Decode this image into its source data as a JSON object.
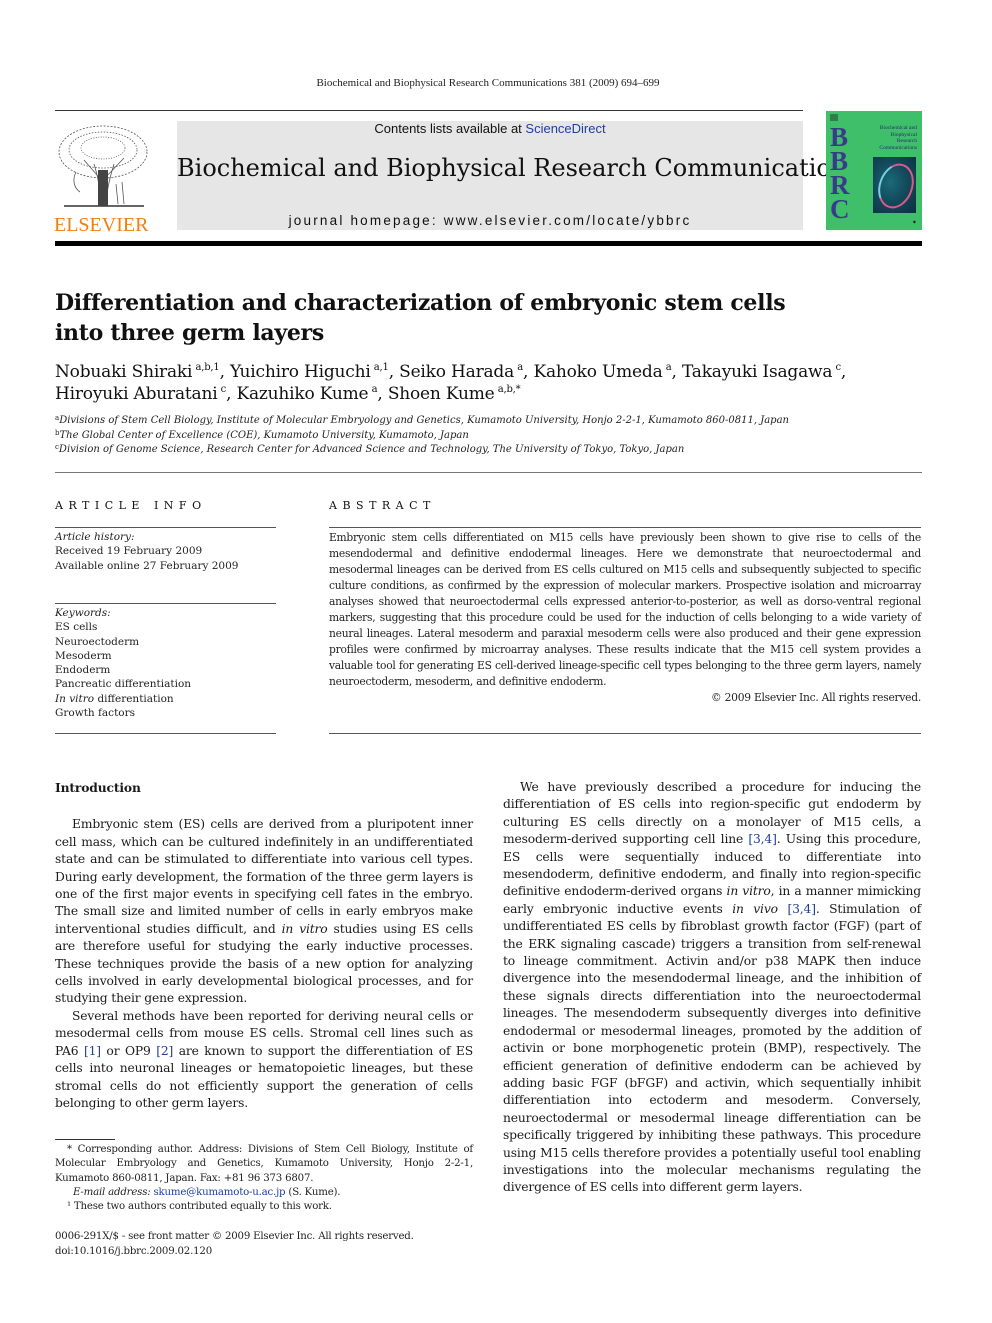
{
  "running_head": "Biochemical and Biophysical Research Communications 381 (2009) 694–699",
  "masthead": {
    "publisher_logo_text": "ELSEVIER",
    "contents_prefix": "Contents lists available at ",
    "contents_link": "ScienceDirect",
    "journal_title": "Biochemical and Biophysical Research Communications",
    "homepage": "journal homepage: www.elsevier.com/locate/ybbrc",
    "cover": {
      "letters": [
        "B",
        "B",
        "R",
        "C"
      ],
      "title_lines": [
        "Biochemical and",
        "Biophysical",
        "Research",
        "Communications"
      ],
      "background_color": "#3fbf6a",
      "letter_color": "#3a3a8c"
    }
  },
  "colors": {
    "elsevier_orange": "#f07f12",
    "link_blue": "#1f3f9c",
    "banner_gray": "#e6e6e6"
  },
  "article": {
    "title_line1": "Differentiation and characterization of embryonic stem cells",
    "title_line2": "into three germ layers",
    "authors": [
      {
        "name": "Nobuaki Shiraki",
        "sup": "a,b,1"
      },
      {
        "name": "Yuichiro Higuchi",
        "sup": "a,1"
      },
      {
        "name": "Seiko Harada",
        "sup": "a"
      },
      {
        "name": "Kahoko Umeda",
        "sup": "a"
      },
      {
        "name": "Takayuki Isagawa",
        "sup": "c"
      },
      {
        "name": "Hiroyuki Aburatani",
        "sup": "c"
      },
      {
        "name": "Kazuhiko Kume",
        "sup": "a"
      },
      {
        "name": "Shoen Kume",
        "sup": "a,b,*"
      }
    ],
    "affiliations": [
      {
        "key": "a",
        "text": "Divisions of Stem Cell Biology, Institute of Molecular Embryology and Genetics, Kumamoto University, Honjo 2-2-1, Kumamoto 860-0811, Japan"
      },
      {
        "key": "b",
        "text": "The Global Center of Excellence (COE), Kumamoto University, Kumamoto, Japan"
      },
      {
        "key": "c",
        "text": "Division of Genome Science, Research Center for Advanced Science and Technology, The University of Tokyo, Tokyo, Japan"
      }
    ]
  },
  "article_info": {
    "heading": "ARTICLE INFO",
    "history_label": "Article history:",
    "received": "Received 19 February 2009",
    "available": "Available online 27 February 2009",
    "keywords_label": "Keywords:",
    "keywords": [
      "ES cells",
      "Neuroectoderm",
      "Mesoderm",
      "Endoderm",
      "Pancreatic differentiation",
      "In vitro differentiation",
      "Growth factors"
    ]
  },
  "abstract": {
    "heading": "ABSTRACT",
    "text": "Embryonic stem cells differentiated on M15 cells have previously been shown to give rise to cells of the mesendodermal and definitive endodermal lineages. Here we demonstrate that neuroectodermal and mesodermal lineages can be derived from ES cells cultured on M15 cells and subsequently subjected to specific culture conditions, as confirmed by the expression of molecular markers. Prospective isolation and microarray analyses showed that neuroectodermal cells expressed anterior-to-posterior, as well as dorso-ventral regional markers, suggesting that this procedure could be used for the induction of cells belonging to a wide variety of neural lineages. Lateral mesoderm and paraxial mesoderm cells were also produced and their gene expression profiles were confirmed by microarray analyses. These results indicate that the M15 cell system provides a valuable tool for generating ES cell-derived lineage-specific cell types belonging to the three germ layers, namely neuroectoderm, mesoderm, and definitive endoderm.",
    "copyright": "© 2009 Elsevier Inc. All rights reserved."
  },
  "body": {
    "intro_heading": "Introduction",
    "col1_p1": {
      "a": "Embryonic stem (ES) cells are derived from a pluripotent inner cell mass, which can be cultured indefinitely in an undifferentiated state and can be stimulated to differentiate into various cell types. During early development, the formation of the three germ layers is one of the first major events in specifying cell fates in the embryo. The small size and limited number of cells in early embryos make interventional studies difficult, and ",
      "i1": "in vitro",
      "b": " studies using ES cells are therefore useful for studying the early inductive processes. These techniques provide the basis of a new option for analyzing cells involved in early developmental biological processes, and for studying their gene expression."
    },
    "col1_p2": {
      "a": "Several methods have been reported for deriving neural cells or mesodermal cells from mouse ES cells. Stromal cell lines such as PA6 ",
      "ref1": "[1]",
      "b": " or OP9 ",
      "ref2": "[2]",
      "c": " are known to support the differentiation of ES cells into neuronal lineages or hematopoietic lineages, but these stromal cells do not efficiently support the generation of cells belonging to other germ layers."
    },
    "col2_p1": {
      "a": "We have previously described a procedure for inducing the differentiation of ES cells into region-specific gut endoderm by culturing ES cells directly on a monolayer of M15 cells, a mesoderm-derived supporting cell line ",
      "ref1": "[3,4]",
      "b": ". Using this procedure, ES cells were sequentially induced to differentiate into mesendoderm, definitive endoderm, and finally into region-specific definitive endoderm-derived organs ",
      "i1": "in vitro",
      "c": ", in a manner mimicking early embryonic inductive events ",
      "i2": "in vivo",
      "d": " ",
      "ref2": "[3,4]",
      "e": ". Stimulation of undifferentiated ES cells by fibroblast growth factor (FGF) (part of the ERK signaling cascade) triggers a transition from self-renewal to lineage commitment. Activin and/or p38 MAPK then induce divergence into the mesendodermal lineage, and the inhibition of these signals directs differentiation into the neuroectodermal lineages. The mesendoderm subsequently diverges into definitive endodermal or mesodermal lineages, promoted by the addition of activin or bone morphogenetic protein (BMP), respectively. The efficient generation of definitive endoderm can be achieved by adding basic FGF (bFGF) and activin, which sequentially inhibit differentiation into ectoderm and mesoderm. Conversely, neuroectodermal or mesodermal lineage differentiation can be specifically triggered by inhibiting these pathways. This procedure using M15 cells therefore provides a potentially useful tool enabling investigations into the molecular mechanisms regulating the divergence of ES cells into different germ layers."
    }
  },
  "footnotes": {
    "corresponding": "* Corresponding author. Address: Divisions of Stem Cell Biology, Institute of Molecular Embryology and Genetics, Kumamoto University, Honjo 2-2-1, Kumamoto 860-0811, Japan. Fax: +81 96 373 6807.",
    "email_label": "E-mail address: ",
    "email": "skume@kumamoto-u.ac.jp",
    "email_suffix": " (S. Kume).",
    "equal_contrib": "¹ These two authors contributed equally to this work."
  },
  "footer": {
    "issn": "0006-291X/$ - see front matter © 2009 Elsevier Inc. All rights reserved.",
    "doi": "doi:10.1016/j.bbrc.2009.02.120"
  }
}
